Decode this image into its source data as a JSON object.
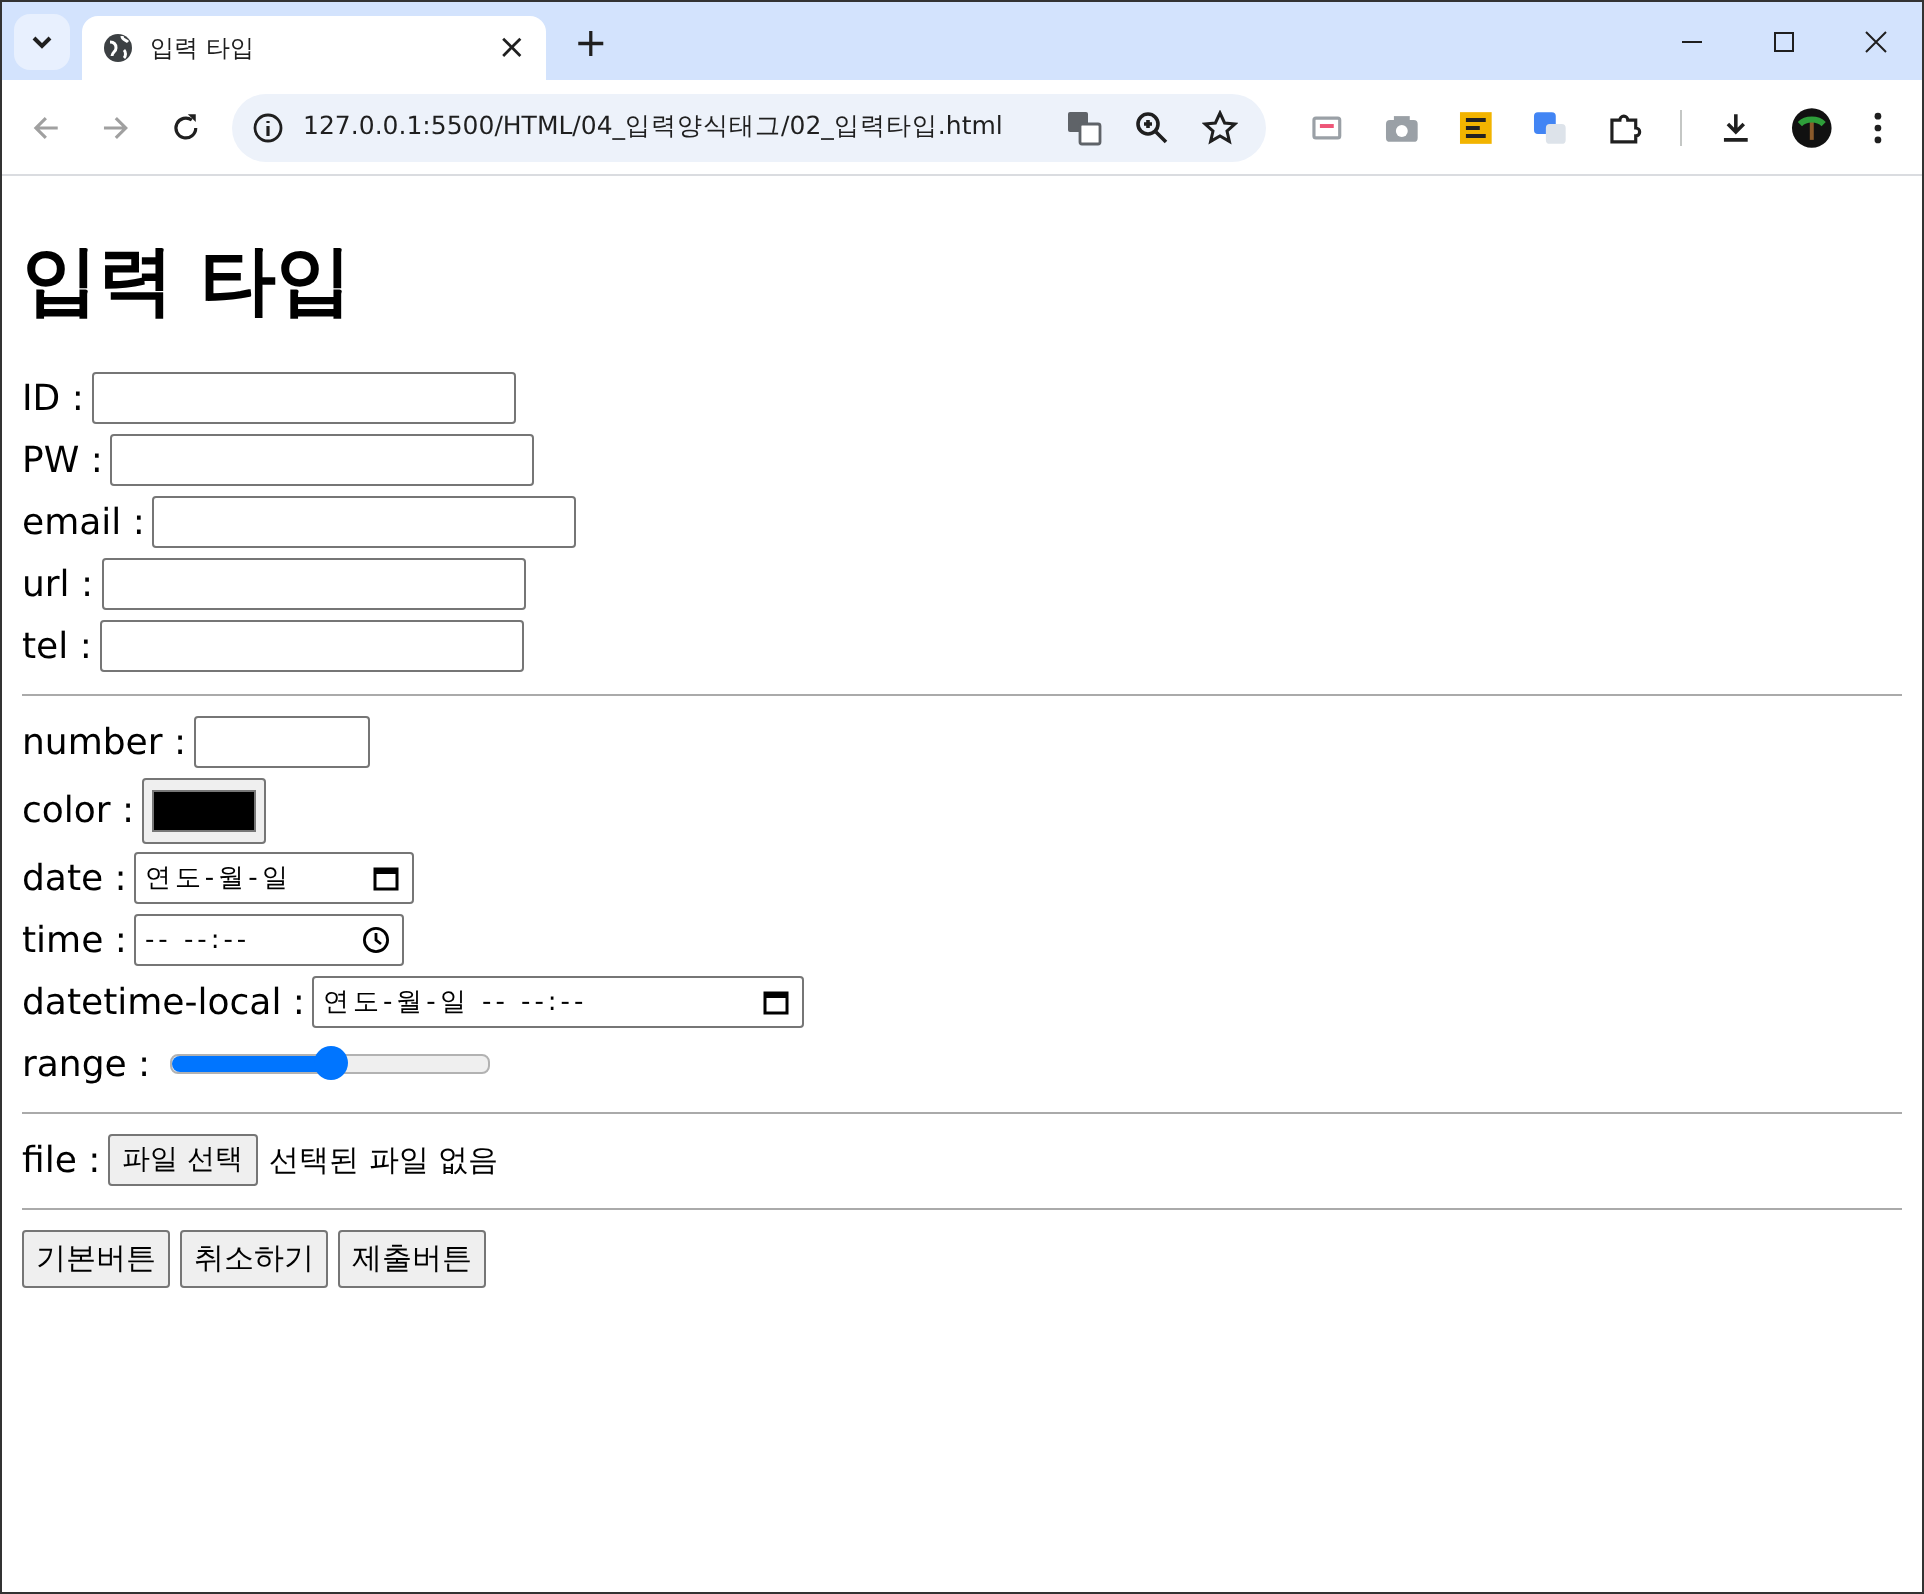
{
  "browser": {
    "tab_title": "입력 타입",
    "tab_close": "×",
    "new_tab": "+",
    "url": "127.0.0.1:5500/HTML/04_입력양식태그/02_입력타입.html"
  },
  "page": {
    "heading": "입력 타입",
    "sections": [
      [
        {
          "kind": "text",
          "label": "ID :"
        },
        {
          "kind": "text",
          "label": "PW :"
        },
        {
          "kind": "text",
          "label": "email :"
        },
        {
          "kind": "text",
          "label": "url :"
        },
        {
          "kind": "text",
          "label": "tel :"
        }
      ],
      [
        {
          "kind": "number",
          "label": "number :"
        },
        {
          "kind": "color",
          "label": "color :",
          "color": "#000000"
        },
        {
          "kind": "date",
          "label": "date :",
          "text": "연도-월-일"
        },
        {
          "kind": "time",
          "label": "time :",
          "text": "-- --:--"
        },
        {
          "kind": "datetime",
          "label": "datetime-local :",
          "text": "연도-월-일 -- --:--"
        },
        {
          "kind": "range",
          "label": "range :",
          "level": 0.5
        }
      ],
      [
        {
          "kind": "file",
          "label": "file :",
          "button": "파일 선택",
          "status": "선택된 파일 없음"
        }
      ]
    ],
    "buttons": [
      "기본버튼",
      "취소하기",
      "제출버튼"
    ]
  }
}
